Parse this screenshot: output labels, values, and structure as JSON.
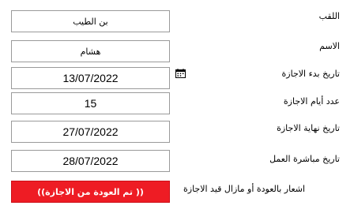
{
  "form": {
    "title_label": "اللقب",
    "title_value": "بن الطيب",
    "name_label": "الاسم",
    "name_value": "هشام",
    "start_date_label": "تاريخ بدء الاجازة",
    "start_date_value": "13/07/2022",
    "days_label": "عدد أيام الاجازة",
    "days_value": "15",
    "end_date_label": "تاريخ نهاية الاجازة",
    "end_date_value": "27/07/2022",
    "resume_date_label": "تاريخ مباشرة العمل",
    "resume_date_value": "28/07/2022",
    "notice_label": "اشعار بالعودة أو مازال قيد الاجازة",
    "notice_value": "(( تم العودة من الاجازة))"
  },
  "icons": {
    "calendar": "calendar-icon"
  },
  "colors": {
    "notice_bg": "#ee1c24",
    "notice_text": "#ffffff",
    "field_border": "#9a9a9a"
  }
}
